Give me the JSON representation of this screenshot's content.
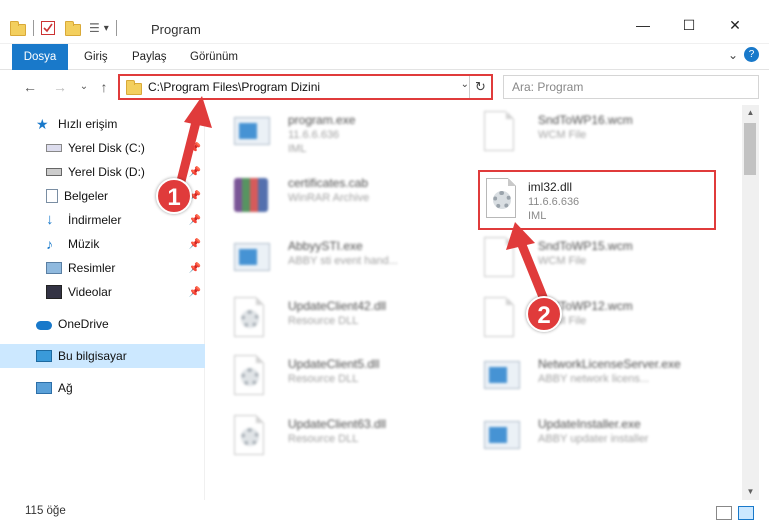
{
  "window": {
    "title": "Program",
    "minimize_label": "—",
    "maximize_label": "☐",
    "close_label": "✕"
  },
  "ribbon": {
    "tabs": [
      "Dosya",
      "Giriş",
      "Paylaş",
      "Görünüm"
    ],
    "collapse_label": "⌄",
    "help_label": "?"
  },
  "nav": {
    "back_label": "←",
    "forward_label": "→",
    "recent_label": "⌄",
    "up_label": "↑",
    "address_path": "C:\\Program Files\\Program Dizini",
    "address_dropdown": "⌄",
    "refresh_label": "↻",
    "search_placeholder": "Ara: Program"
  },
  "sidebar": {
    "items": [
      {
        "label": "Hızlı erişim",
        "icon": "star-icon",
        "pinned": false
      },
      {
        "label": "Yerel Disk (C:)",
        "icon": "drive-icon",
        "pinned": true
      },
      {
        "label": "Yerel Disk (D:)",
        "icon": "drive-icon",
        "pinned": true
      },
      {
        "label": "Belgeler",
        "icon": "documents-icon",
        "pinned": true
      },
      {
        "label": "İndirmeler",
        "icon": "download-icon",
        "pinned": true
      },
      {
        "label": "Müzik",
        "icon": "music-icon",
        "pinned": true
      },
      {
        "label": "Resimler",
        "icon": "pictures-icon",
        "pinned": true
      },
      {
        "label": "Videolar",
        "icon": "videos-icon",
        "pinned": true
      },
      {
        "label": "OneDrive",
        "icon": "cloud-icon",
        "pinned": false
      },
      {
        "label": "Bu bilgisayar",
        "icon": "computer-icon",
        "pinned": false,
        "selected": true
      },
      {
        "label": "Ağ",
        "icon": "network-icon",
        "pinned": false
      }
    ],
    "pin_glyph": "📌"
  },
  "files": [
    {
      "name": "program.exe",
      "sub1": "11.6.6.636",
      "sub2": "IML",
      "icon": "installer-icon"
    },
    {
      "name": "SndToWP16.wcm",
      "sub1": "WCM File",
      "sub2": "",
      "icon": "blank-file-icon"
    },
    {
      "name": "certificates.cab",
      "sub1": "WinRAR Archive",
      "sub2": "",
      "icon": "archive-icon"
    },
    {
      "name": "iml32.dll",
      "sub1": "11.6.6.636",
      "sub2": "IML",
      "icon": "dll-gear-icon",
      "highlighted": true
    },
    {
      "name": "AbbyySTI.exe",
      "sub1": "ABBY sti event hand...",
      "sub2": "",
      "icon": "app-icon"
    },
    {
      "name": "SndToWP15.wcm",
      "sub1": "WCM File",
      "sub2": "",
      "icon": "blank-file-icon"
    },
    {
      "name": "UpdateClient42.dll",
      "sub1": "Resource DLL",
      "sub2": "",
      "icon": "dll-gear-icon"
    },
    {
      "name": "SndToWP12.wcm",
      "sub1": "WCM File",
      "sub2": "",
      "icon": "blank-file-icon"
    },
    {
      "name": "UpdateClient5.dll",
      "sub1": "Resource DLL",
      "sub2": "",
      "icon": "dll-gear-icon"
    },
    {
      "name": "NetworkLicenseServer.exe",
      "sub1": "ABBY network licens...",
      "sub2": "",
      "icon": "app-icon"
    },
    {
      "name": "UpdateClient63.dll",
      "sub1": "Resource DLL",
      "sub2": "",
      "icon": "dll-gear-icon"
    },
    {
      "name": "UpdateInstaller.exe",
      "sub1": "ABBY updater installer",
      "sub2": "",
      "icon": "app-icon"
    }
  ],
  "status": {
    "item_count": "115 öğe"
  },
  "callouts": {
    "one": "1",
    "two": "2"
  },
  "colors": {
    "accent": "#1979ca",
    "highlight_border": "#e03b3b",
    "selected_bg": "#cce8ff"
  }
}
